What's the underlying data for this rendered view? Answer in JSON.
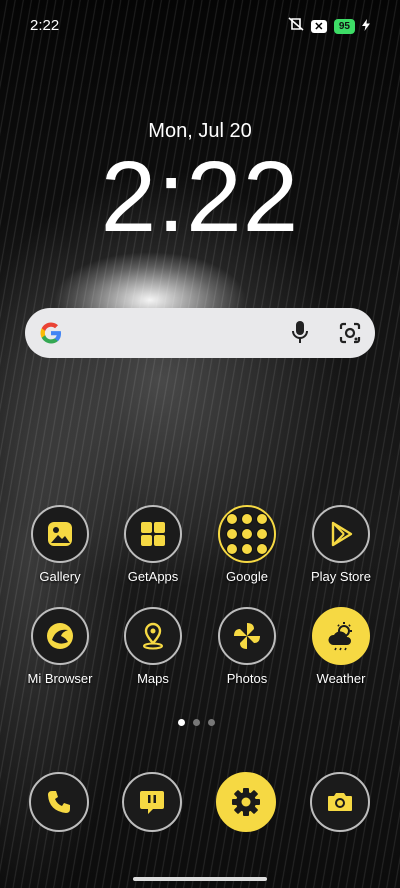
{
  "status": {
    "time": "2:22",
    "battery": "95"
  },
  "lockscreen": {
    "date": "Mon, Jul 20",
    "time": "2:22"
  },
  "apps": [
    {
      "label": "Gallery"
    },
    {
      "label": "GetApps"
    },
    {
      "label": "Google"
    },
    {
      "label": "Play Store"
    },
    {
      "label": "Mi Browser"
    },
    {
      "label": "Maps"
    },
    {
      "label": "Photos"
    },
    {
      "label": "Weather"
    }
  ],
  "dock": [
    "phone-icon",
    "messages-icon",
    "settings-icon",
    "camera-icon"
  ],
  "theme": {
    "accent": "#f6d943"
  }
}
